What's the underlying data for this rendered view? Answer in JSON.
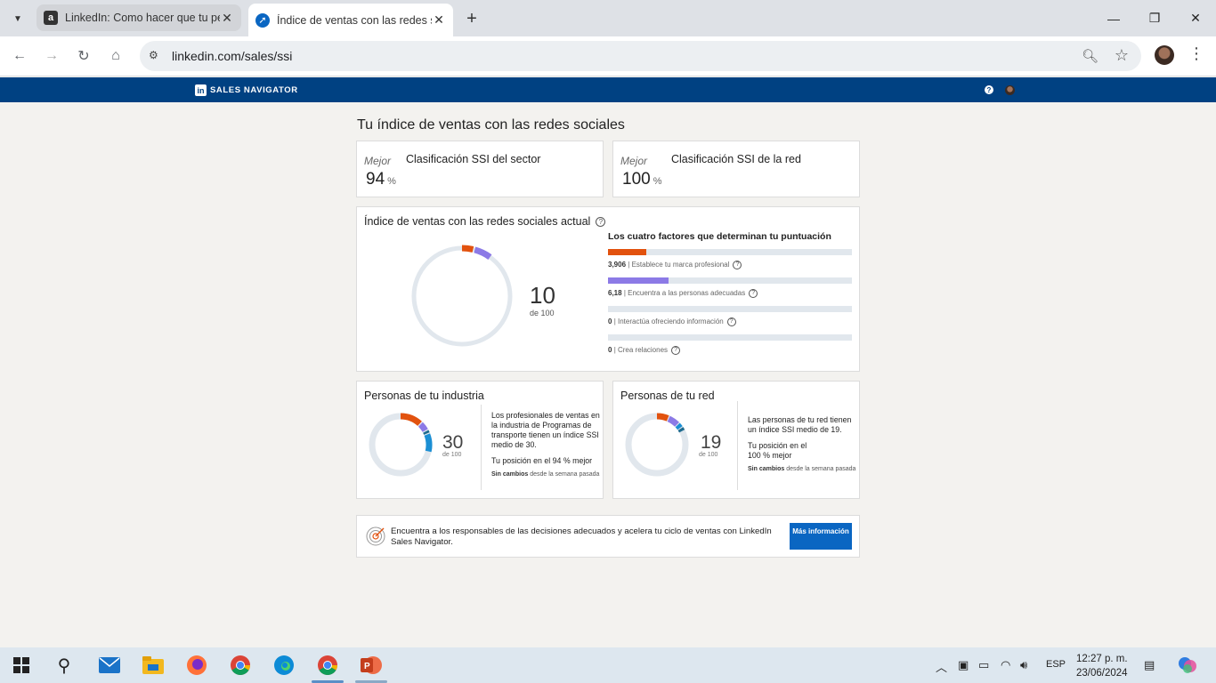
{
  "browser": {
    "tabs": [
      {
        "title": "LinkedIn: Como hacer que tu pe",
        "active": false
      },
      {
        "title": "Índice de ventas con las redes s",
        "active": true
      }
    ],
    "url": "linkedin.com/sales/ssi"
  },
  "header": {
    "brand": "SALES NAVIGATOR",
    "logo_text": "in"
  },
  "page": {
    "title": "Tu índice de ventas con las redes sociales"
  },
  "rankings": [
    {
      "label": "Mejor",
      "title": "Clasificación SSI del sector",
      "value": "94",
      "unit": "%"
    },
    {
      "label": "Mejor",
      "title": "Clasificación SSI de la red",
      "value": "100",
      "unit": "%"
    }
  ],
  "ssi": {
    "title": "Índice de ventas con las redes sociales actual",
    "score": "10",
    "out_of": "de 100",
    "factors_title": "Los cuatro factores que determinan tu puntuación",
    "factors": [
      {
        "value": "3,906",
        "label": "| Establece tu marca profesional",
        "fraction": 0.156,
        "color": "#e2520e"
      },
      {
        "value": "6,18",
        "label": "| Encuentra a las personas adecuadas",
        "fraction": 0.247,
        "color": "#8c7ae6"
      },
      {
        "value": "0",
        "label": "| Interactúa ofreciendo información",
        "fraction": 0,
        "color": "#1b8fd4"
      },
      {
        "value": "0",
        "label": "| Crea relaciones",
        "fraction": 0,
        "color": "#1e6b8f"
      }
    ]
  },
  "industry": {
    "title": "Personas de tu industria",
    "score": "30",
    "out_of": "de 100",
    "description": "Los profesionales de ventas en la industria de Programas de transporte tienen un índice SSI medio de 30.",
    "position": "Tu posición en el 94 % mejor",
    "change_bold": "Sin cambios",
    "change_rest": "desde la semana pasada"
  },
  "network": {
    "title": "Personas de tu red",
    "score": "19",
    "out_of": "de 100",
    "description": "Las personas de tu red tienen un índice SSI medio de 19.",
    "position": "Tu posición en el 100 % mejor",
    "change_bold": "Sin cambios",
    "change_rest": "desde la semana pasada"
  },
  "promo": {
    "text": "Encuentra a los responsables de las decisiones adecuados y acelera tu ciclo de ventas con LinkedIn Sales Navigator.",
    "button": "Más información"
  },
  "taskbar": {
    "lang": "ESP",
    "time": "12:27 p. m.",
    "date": "23/06/2024"
  }
}
